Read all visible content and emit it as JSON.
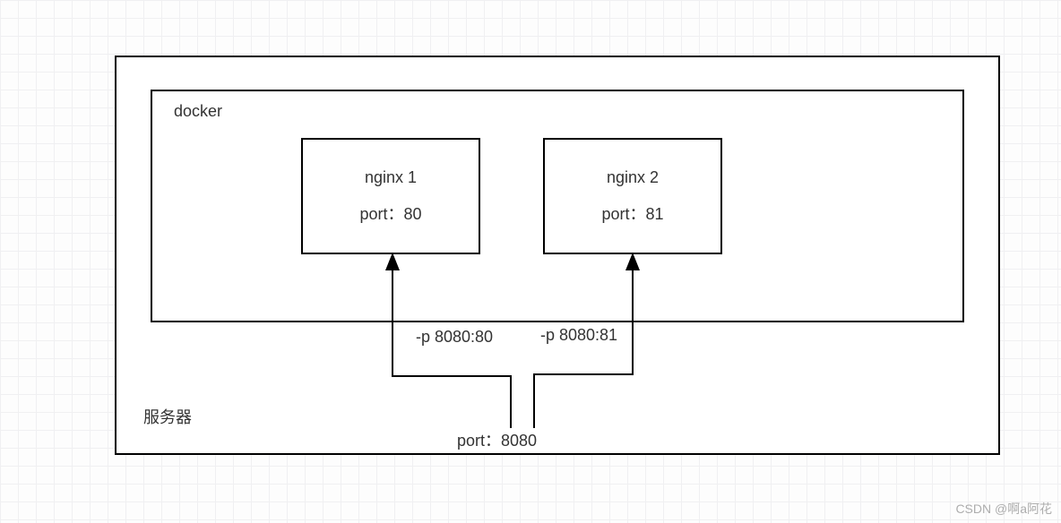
{
  "server": {
    "label": "服务器",
    "port_label": "port：8080"
  },
  "docker": {
    "label": "docker"
  },
  "containers": {
    "nginx1": {
      "title": "nginx 1",
      "port": "port：80",
      "mapping": "-p 8080:80"
    },
    "nginx2": {
      "title": "nginx 2",
      "port": "port：81",
      "mapping": "-p 8080:81"
    }
  },
  "watermark": "CSDN @啊a阿花",
  "chart_data": {
    "type": "diagram",
    "description": "Docker port mapping from server host port 8080 to two nginx containers",
    "host": {
      "port": 8080
    },
    "docker_containers": [
      {
        "name": "nginx 1",
        "container_port": 80,
        "mapping": "-p 8080:80"
      },
      {
        "name": "nginx 2",
        "container_port": 81,
        "mapping": "-p 8080:81"
      }
    ]
  }
}
